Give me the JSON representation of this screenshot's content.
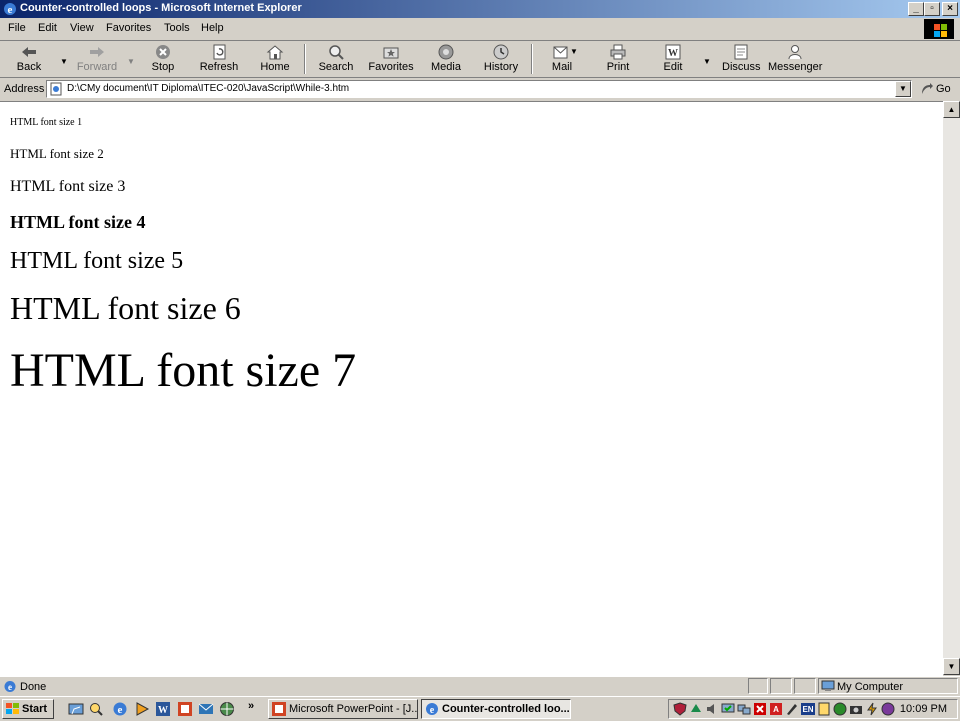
{
  "window": {
    "title": "Counter-controlled loops - Microsoft Internet Explorer"
  },
  "window_buttons": {
    "minimize_glyph": "_",
    "maximize_glyph": "▫",
    "close_glyph": "×"
  },
  "menu": {
    "items": [
      "File",
      "Edit",
      "View",
      "Favorites",
      "Tools",
      "Help"
    ]
  },
  "toolbar": {
    "buttons": [
      {
        "label": "Back",
        "icon": "back-arrow-icon",
        "enabled": true
      },
      {
        "label": "Forward",
        "icon": "forward-arrow-icon",
        "enabled": false
      },
      {
        "label": "Stop",
        "icon": "stop-icon",
        "enabled": true
      },
      {
        "label": "Refresh",
        "icon": "refresh-icon",
        "enabled": true
      },
      {
        "label": "Home",
        "icon": "home-icon",
        "enabled": true
      },
      {
        "label": "Search",
        "icon": "search-icon",
        "enabled": true
      },
      {
        "label": "Favorites",
        "icon": "favorites-icon",
        "enabled": true
      },
      {
        "label": "Media",
        "icon": "media-icon",
        "enabled": true
      },
      {
        "label": "History",
        "icon": "history-icon",
        "enabled": true
      },
      {
        "label": "Mail",
        "icon": "mail-icon",
        "enabled": true
      },
      {
        "label": "Print",
        "icon": "print-icon",
        "enabled": true
      },
      {
        "label": "Edit",
        "icon": "word-edit-icon",
        "enabled": true
      },
      {
        "label": "Discuss",
        "icon": "discuss-icon",
        "enabled": true
      },
      {
        "label": "Messenger",
        "icon": "messenger-icon",
        "enabled": true
      }
    ]
  },
  "address": {
    "label": "Address",
    "url": "D:\\CMy document\\IT Diploma\\ITEC-020\\JavaScript\\While-3.htm",
    "go_label": "Go"
  },
  "page": {
    "lines": [
      "HTML font size 1",
      "HTML font size 2",
      "HTML font size 3",
      "HTML font size 4",
      "HTML font size 5",
      "HTML font size 6",
      "HTML font size 7"
    ]
  },
  "status": {
    "text": "Done",
    "zone": "My Computer"
  },
  "taskbar": {
    "start_label": "Start",
    "quicklaunch_more": "»",
    "tasks": [
      {
        "label": "Microsoft PowerPoint - [J...",
        "active": false
      },
      {
        "label": "Counter-controlled loo...",
        "active": true
      }
    ],
    "clock": "10:09 PM"
  },
  "colors": {
    "titlebar_start": "#0a246a",
    "titlebar_end": "#a6caf0",
    "chrome": "#d4d0c8",
    "content_bg": "#ffffff"
  }
}
